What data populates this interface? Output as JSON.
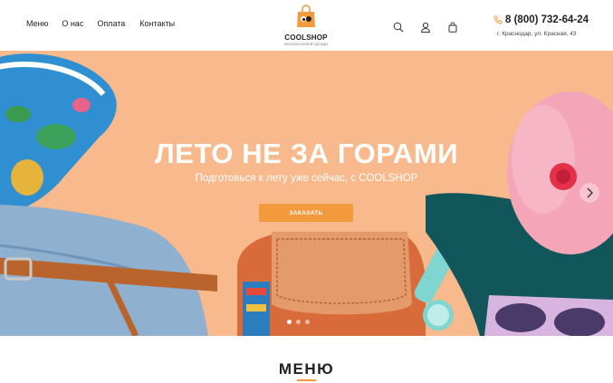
{
  "nav": {
    "items": [
      "Меню",
      "О нас",
      "Оплата",
      "Контакты"
    ]
  },
  "logo": {
    "name": "COOLSHOP",
    "tagline": "МАГАЗИН КЛЕВОЙ ОДЕЖДЫ"
  },
  "header_icons": [
    "search-icon",
    "user-icon",
    "cart-icon"
  ],
  "contacts": {
    "phone": "8 (800) 732-64-24",
    "address": "г. Краснодар, ул. Красная, 43"
  },
  "hero": {
    "title": "ЛЕТО НЕ ЗА ГОРАМИ",
    "subtitle": "Подготовься к лету уже сейчас, с COOLSHOP",
    "cta_label": "ЗАКАЗАТЬ",
    "slide_count": 3,
    "active_slide": 1
  },
  "section": {
    "title": "МЕНЮ"
  },
  "colors": {
    "accent": "#f39a3d",
    "hero_bg": "#f8b98d",
    "text": "#222222"
  }
}
